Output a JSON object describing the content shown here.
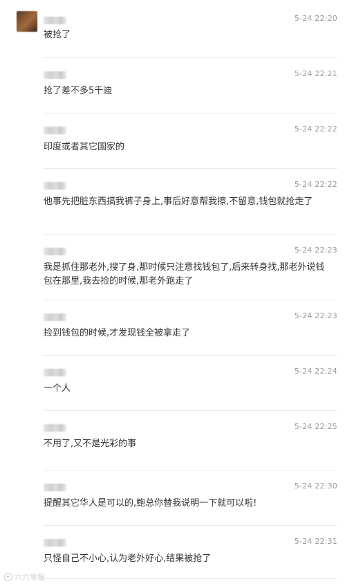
{
  "messages": [
    {
      "time": "5-24 22:20",
      "text": "被抢了"
    },
    {
      "time": "5-24 22:21",
      "text": "抢了差不多5千迪"
    },
    {
      "time": "5-24 22:22",
      "text": "印度或者其它国家的"
    },
    {
      "time": "5-24 22:22",
      "text": "他事先把脏东西搞我裤子身上,事后好意帮我擦,不留意,钱包就抢走了"
    },
    {
      "time": "5-24 22:23",
      "text": "我是抓住那老外,搜了身,那时候只注意找钱包了,后来转身找,那老外说钱包在那里,我去捡的时候,那老外跑走了"
    },
    {
      "time": "5-24 22:23",
      "text": "捡到钱包的时候,才发现钱全被拿走了"
    },
    {
      "time": "5-24 22:24",
      "text": "一个人"
    },
    {
      "time": "5-24 22:25",
      "text": "不用了,又不是光彩的事"
    },
    {
      "time": "5-24 22:30",
      "text": "提醒其它华人是可以的,鲍总你替我说明一下就可以啦!"
    },
    {
      "time": "5-24 22:31",
      "text": "只怪自己不小心,认为老外好心,结果被抢了"
    }
  ],
  "watermark": {
    "text": "六六导报"
  }
}
